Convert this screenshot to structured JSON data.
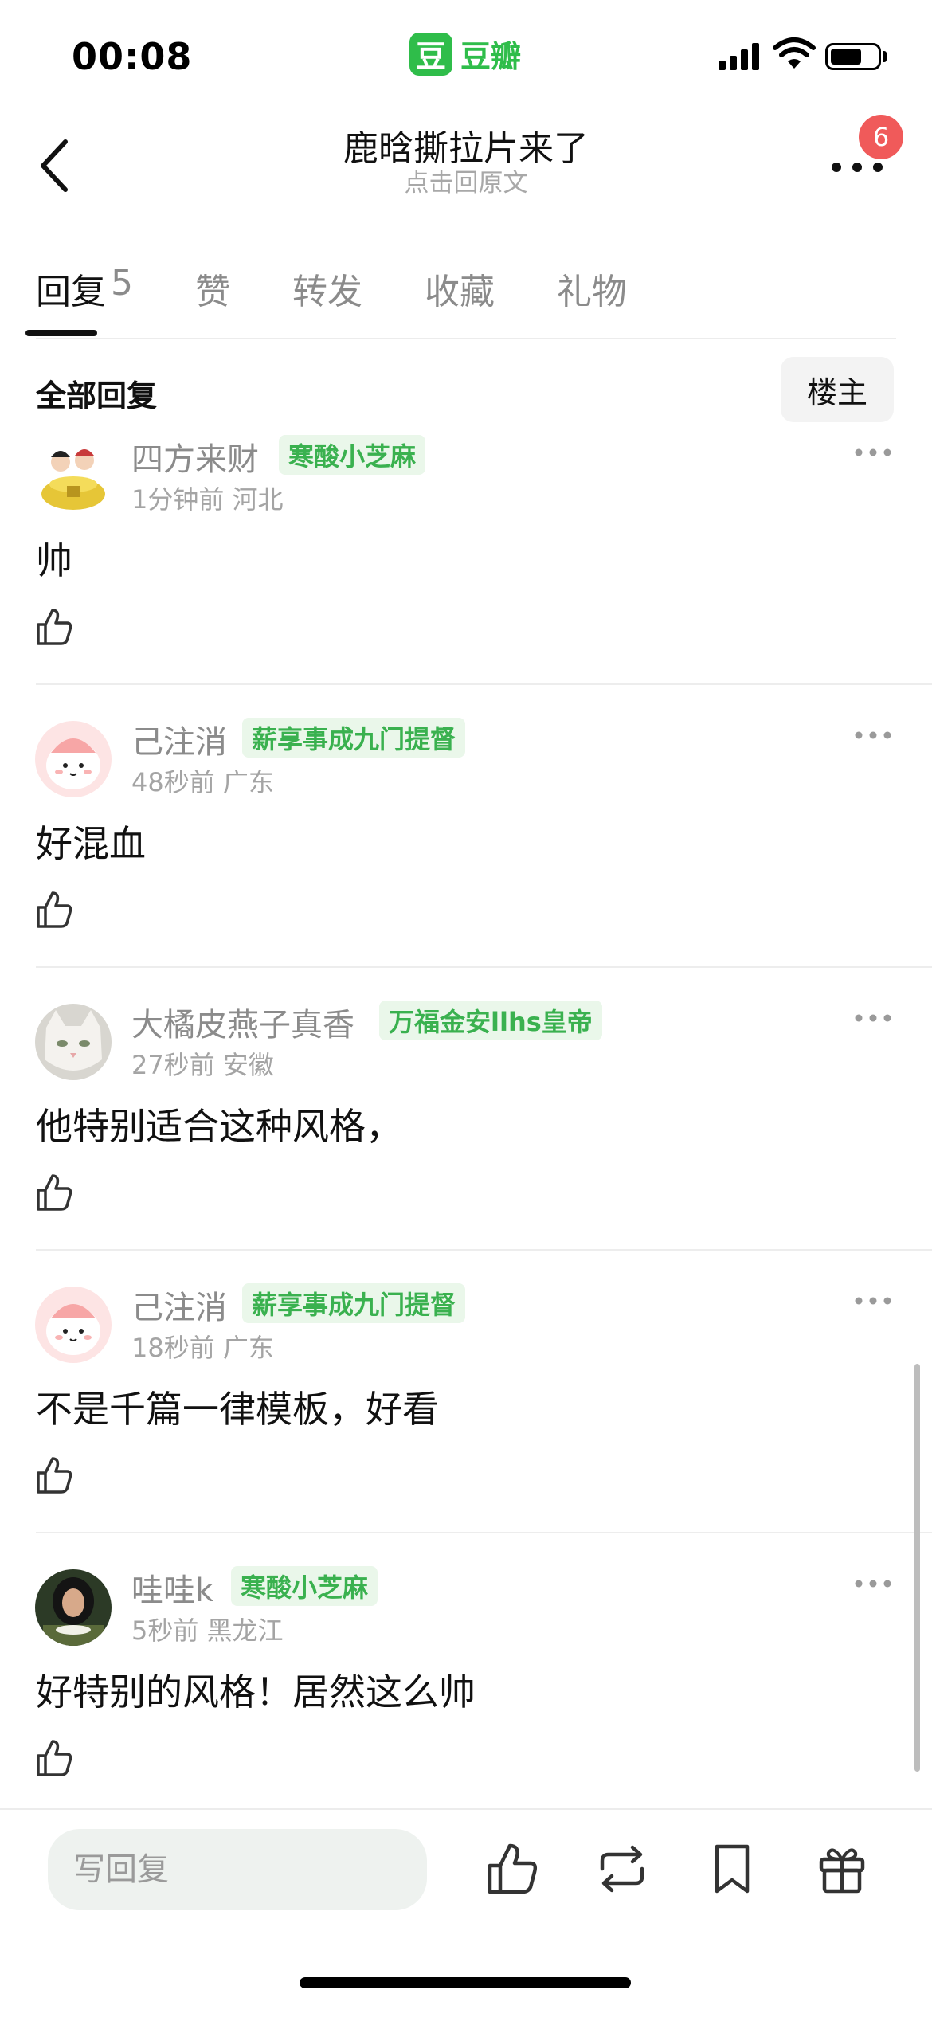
{
  "status_bar": {
    "time": "00:08",
    "app_logo_char": "豆",
    "app_name": "豆瓣"
  },
  "nav": {
    "title": "鹿晗撕拉片来了",
    "subtitle": "点击回原文",
    "notification_count": "6"
  },
  "tabs": [
    {
      "label": "回复",
      "count": "5",
      "active": true
    },
    {
      "label": "赞"
    },
    {
      "label": "转发"
    },
    {
      "label": "收藏"
    },
    {
      "label": "礼物"
    }
  ],
  "filter": {
    "label": "全部回复",
    "op_button": "楼主"
  },
  "comments": [
    {
      "username": "四方来财",
      "badge": "寒酸小芝麻",
      "time": "1分钟前",
      "location": "河北",
      "content": "帅",
      "avatar": "ingot-avatar"
    },
    {
      "username": "己注消",
      "badge": "薪享事成九门提督",
      "time": "48秒前",
      "location": "广东",
      "content": "好混血",
      "avatar": "cartoon-pink-avatar"
    },
    {
      "username": "大橘皮燕子真香",
      "badge": "万福金安llhs皇帝",
      "time": "27秒前",
      "location": "安徽",
      "content": "他特别适合这种风格，",
      "avatar": "cat-avatar"
    },
    {
      "username": "己注消",
      "badge": "薪享事成九门提督",
      "time": "18秒前",
      "location": "广东",
      "content": "不是千篇一律模板，好看",
      "avatar": "cartoon-pink-avatar"
    },
    {
      "username": "哇哇k",
      "badge": "寒酸小芝麻",
      "time": "5秒前",
      "location": "黑龙江",
      "content": "好特别的风格！居然这么帅",
      "avatar": "photo-avatar"
    }
  ],
  "bottom_bar": {
    "reply_placeholder": "写回复",
    "icons": [
      "thumbs-up-icon",
      "repost-icon",
      "bookmark-icon",
      "gift-icon"
    ]
  },
  "colors": {
    "accent_green": "#2fbd4a",
    "badge_text": "#3ab14f",
    "badge_bg": "#eaf7ea",
    "notification_red": "#f05a5a"
  }
}
